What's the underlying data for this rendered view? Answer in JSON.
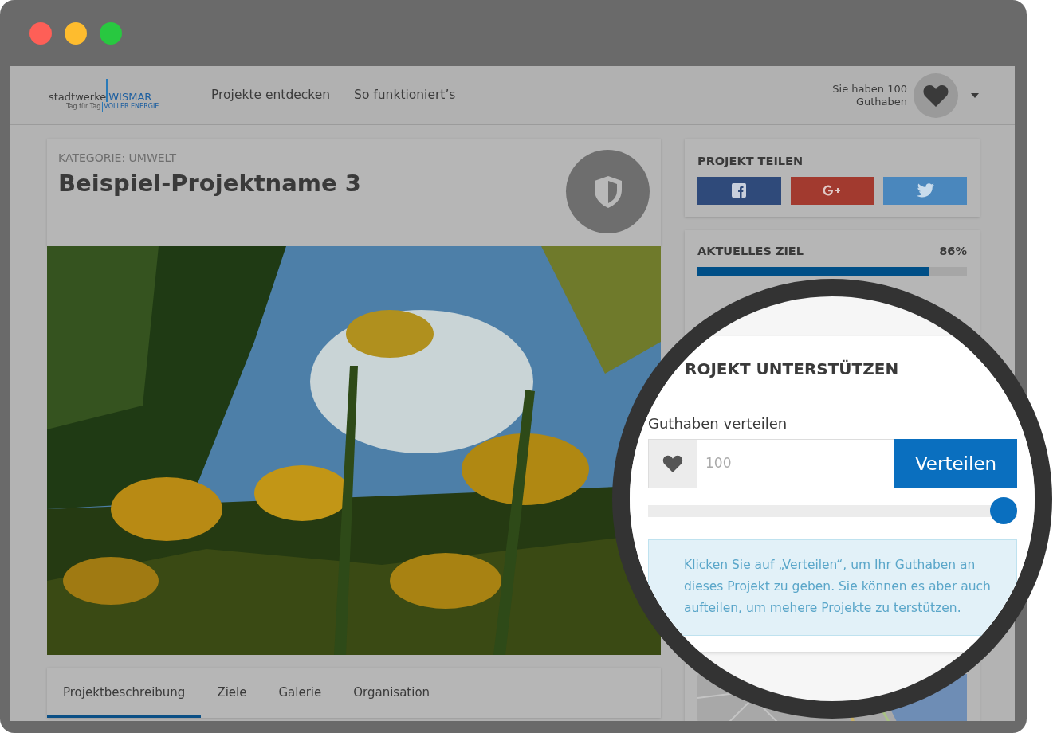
{
  "header": {
    "logo": {
      "name": "stadtwerke",
      "brand": "WISMAR",
      "slogan": "Tag für Tag",
      "slogan_brand": "VOLLER ENERGIE"
    },
    "nav": [
      {
        "label": "Projekte entdecken"
      },
      {
        "label": "So funktioniert’s"
      }
    ],
    "balance": {
      "line_1": "Sie haben 100",
      "line_2": "Guthaben"
    }
  },
  "project": {
    "category": "KATEGORIE: UMWELT",
    "title": "Beispiel-Projektname 3",
    "tabs": [
      {
        "label": "Projektbeschreibung",
        "selected": true
      },
      {
        "label": "Ziele",
        "selected": false
      },
      {
        "label": "Galerie",
        "selected": false
      },
      {
        "label": "Organisation",
        "selected": false
      }
    ]
  },
  "share": {
    "title": "PROJEKT TEILEN",
    "buttons": [
      {
        "kind": "facebook"
      },
      {
        "kind": "google"
      },
      {
        "kind": "twitter"
      }
    ]
  },
  "goal": {
    "title": "AKTUELLES ZIEL",
    "percent": "86%",
    "level": 0.86
  },
  "magnifier": {
    "heading": "ROJEKT UNTERSTÜTZEN",
    "label": "Guthaben verteilen",
    "placeholder": "100",
    "button": "Verteilen",
    "slider": {
      "level": 1
    },
    "info": "Klicken Sie auf „Verteilen“, um Ihr Guthaben an dieses Projekt zu geben. Sie können es aber auch aufteilen, um mehere Projekte zu terstützen."
  }
}
